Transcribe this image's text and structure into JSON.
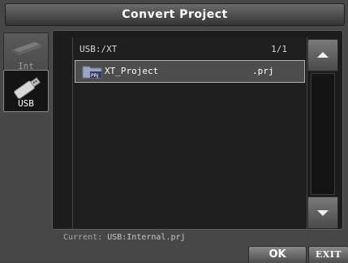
{
  "dialog": {
    "title": "Convert Project"
  },
  "sidebar": {
    "items": [
      {
        "label": "Int",
        "icon": "internal-storage-icon",
        "selected": false
      },
      {
        "label": "USB",
        "icon": "usb-drive-icon",
        "selected": true
      }
    ]
  },
  "browser": {
    "path": "USB:/XT",
    "page": "1/1",
    "files": [
      {
        "icon": "project-folder-icon",
        "icon_badge": "PRJ",
        "name": "XT_Project",
        "ext": ".prj",
        "selected": true
      }
    ]
  },
  "scrollbar": {
    "up_icon": "triangle-up-icon",
    "down_icon": "triangle-down-icon"
  },
  "footer": {
    "current_label": "Current:",
    "current_value": "USB:Internal.prj",
    "ok_label": "OK",
    "exit_label": "EXIT"
  },
  "colors": {
    "background": "#474747",
    "panel": "#1c1c1c",
    "selection": "#4d4d4d",
    "folder": "#9aa6c8"
  }
}
